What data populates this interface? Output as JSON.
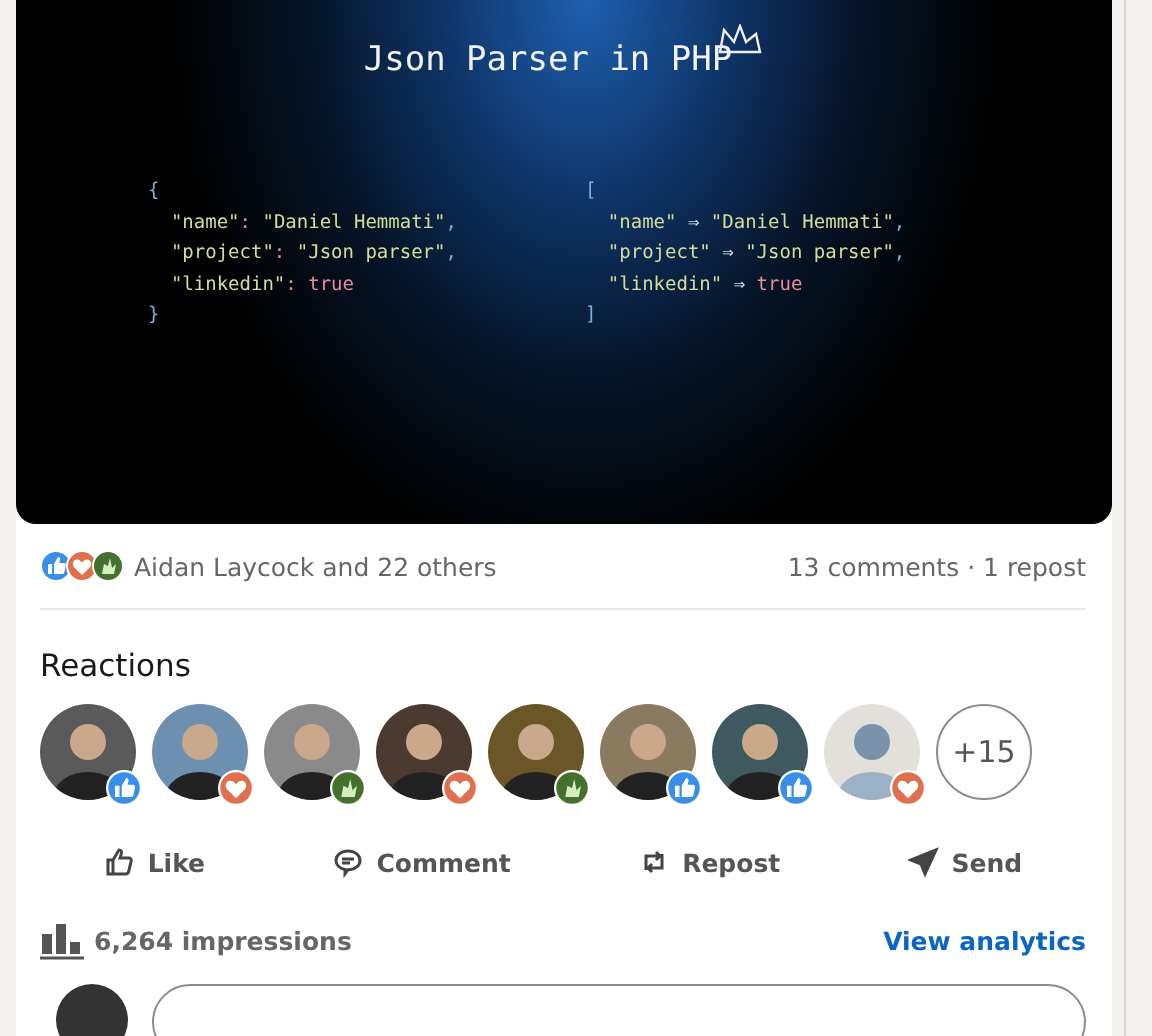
{
  "post_image": {
    "title": "Json Parser in PHP",
    "code_left": [
      [
        {
          "kind": "punct",
          "text": "{"
        }
      ],
      [
        {
          "kind": "key",
          "text": "  \"name\""
        },
        {
          "kind": "op",
          "text": ": "
        },
        {
          "kind": "string",
          "text": "\"Daniel Hemmati\""
        },
        {
          "kind": "punct",
          "text": ","
        }
      ],
      [
        {
          "kind": "key",
          "text": "  \"project\""
        },
        {
          "kind": "op",
          "text": ": "
        },
        {
          "kind": "string",
          "text": "\"Json parser\""
        },
        {
          "kind": "punct",
          "text": ","
        }
      ],
      [
        {
          "kind": "key",
          "text": "  \"linkedin\""
        },
        {
          "kind": "op",
          "text": ": "
        },
        {
          "kind": "bool",
          "text": "true"
        }
      ],
      [
        {
          "kind": "punct",
          "text": "}"
        }
      ]
    ],
    "code_right": [
      [
        {
          "kind": "punct",
          "text": "["
        }
      ],
      [
        {
          "kind": "key",
          "text": "  \"name\""
        },
        {
          "kind": "arrow",
          "text": " ⇒ "
        },
        {
          "kind": "string",
          "text": "\"Daniel Hemmati\""
        },
        {
          "kind": "punct",
          "text": ","
        }
      ],
      [
        {
          "kind": "key",
          "text": "  \"project\""
        },
        {
          "kind": "arrow",
          "text": " ⇒ "
        },
        {
          "kind": "string",
          "text": "\"Json parser\""
        },
        {
          "kind": "punct",
          "text": ","
        }
      ],
      [
        {
          "kind": "key",
          "text": "  \"linkedin\""
        },
        {
          "kind": "arrow",
          "text": " ⇒ "
        },
        {
          "kind": "bool",
          "text": "true"
        }
      ],
      [
        {
          "kind": "punct",
          "text": "]"
        }
      ]
    ]
  },
  "social_counts": {
    "reaction_kinds": [
      {
        "kind": "like"
      },
      {
        "kind": "love"
      },
      {
        "kind": "celebrate"
      }
    ],
    "reactors": "Aidan Laycock and 22 others",
    "comments_reposts": "13 comments · 1 repost"
  },
  "reactions": {
    "title": "Reactions",
    "people": [
      {
        "kind": "like",
        "photo": true
      },
      {
        "kind": "love",
        "photo": true
      },
      {
        "kind": "celebrate",
        "photo": true
      },
      {
        "kind": "love",
        "photo": true
      },
      {
        "kind": "celebrate",
        "photo": true
      },
      {
        "kind": "like",
        "photo": true
      },
      {
        "kind": "like",
        "photo": true
      },
      {
        "kind": "love",
        "photo": false
      }
    ],
    "more": "+15"
  },
  "actions": [
    {
      "kind": "like",
      "label": "Like"
    },
    {
      "kind": "comment",
      "label": "Comment"
    },
    {
      "kind": "repost",
      "label": "Repost"
    },
    {
      "kind": "send",
      "label": "Send"
    }
  ],
  "analytics": {
    "impressions": "6,264 impressions",
    "link": "View analytics"
  }
}
